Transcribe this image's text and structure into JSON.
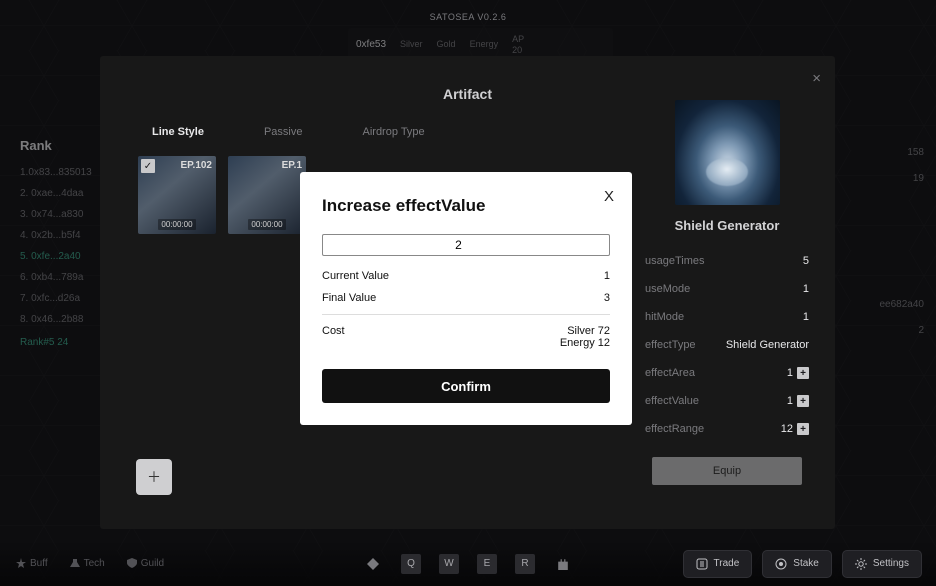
{
  "app_title": "SATOSEA V0.2.6",
  "resources": {
    "address": "0xfe53",
    "silver_label": "Silver",
    "gold_label": "Gold",
    "energy_label": "Energy",
    "ap_label": "AP",
    "ap_value": "20"
  },
  "rank": {
    "title": "Rank",
    "rows": [
      "1.0x83...835013",
      "2. 0xae...4daa",
      "3. 0x74...a830",
      "4. 0x2b...b5f4",
      "5. 0xfe...2a40",
      "6. 0xb4...789a",
      "7. 0xfc...d26a",
      "8. 0x46...2b88"
    ],
    "self_index": 4,
    "footer": "Rank#5   24"
  },
  "ghost_right": [
    "158",
    "19",
    "ee682a40",
    "2"
  ],
  "artifact_panel": {
    "title": "Artifact",
    "tabs": [
      "Line Style",
      "Passive",
      "Airdrop Type"
    ],
    "active_tab": 0,
    "cards": [
      {
        "ep": "EP.102",
        "timer": "00:00:00",
        "checked": true
      },
      {
        "ep": "EP.1",
        "timer": "00:00:00",
        "checked": false
      }
    ],
    "add_button_glyph": "＋＋",
    "details": {
      "name": "Shield Generator",
      "props": [
        {
          "k": "usageTimes",
          "v": "5",
          "plus": false
        },
        {
          "k": "useMode",
          "v": "1",
          "plus": false
        },
        {
          "k": "hitMode",
          "v": "1",
          "plus": false
        },
        {
          "k": "effectType",
          "v": "Shield Generator",
          "plus": false
        },
        {
          "k": "effectArea",
          "v": "1",
          "plus": true
        },
        {
          "k": "effectValue",
          "v": "1",
          "plus": true
        },
        {
          "k": "effectRange",
          "v": "12",
          "plus": true
        }
      ],
      "equip_label": "Equip"
    }
  },
  "dialog": {
    "title": "Increase effectValue",
    "input_value": "2",
    "current_label": "Current Value",
    "current_value": "1",
    "final_label": "Final Value",
    "final_value": "3",
    "cost_label": "Cost",
    "cost_lines": [
      "Silver 72",
      "Energy 12"
    ],
    "confirm_label": "Confirm",
    "close_glyph": "X"
  },
  "dock": {
    "left": [
      {
        "label": "Buff"
      },
      {
        "label": "Tech"
      },
      {
        "label": "Guild"
      }
    ],
    "keys": [
      "Q",
      "W",
      "E",
      "R"
    ],
    "right": [
      {
        "label": "Trade"
      },
      {
        "label": "Stake"
      },
      {
        "label": "Settings"
      }
    ]
  }
}
